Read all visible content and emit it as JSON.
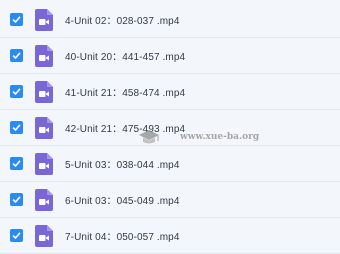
{
  "files": [
    {
      "name": "4-Unit 02：028-037 .mp4",
      "checked": true
    },
    {
      "name": "40-Unit 20：441-457 .mp4",
      "checked": true
    },
    {
      "name": "41-Unit 21：458-474 .mp4",
      "checked": true
    },
    {
      "name": "42-Unit 21：475-493 .mp4",
      "checked": true
    },
    {
      "name": "5-Unit 03：038-044 .mp4",
      "checked": true
    },
    {
      "name": "6-Unit 03：045-049 .mp4",
      "checked": true
    },
    {
      "name": "7-Unit 04：050-057 .mp4",
      "checked": true
    }
  ],
  "watermark": {
    "text": "www.xue-ba.org"
  },
  "colors": {
    "checkbox": "#2a8bf2",
    "video_icon": "#7a66d6"
  },
  "icons": {
    "checkbox": "check-icon",
    "file": "video-file-icon",
    "watermark": "graduation-cap-icon"
  }
}
